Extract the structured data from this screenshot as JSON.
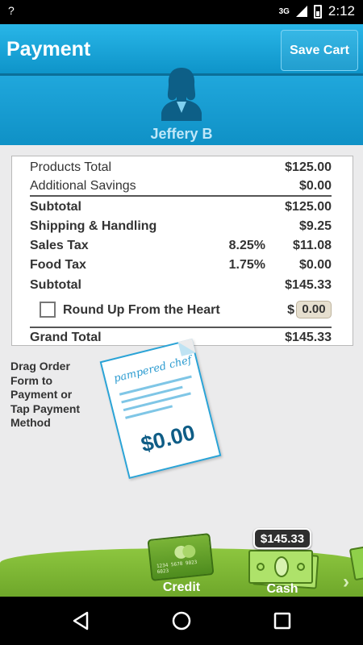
{
  "status_bar": {
    "left_icon": "?",
    "network": "3G",
    "time": "2:12"
  },
  "header": {
    "title": "Payment",
    "save_label": "Save Cart"
  },
  "profile": {
    "name": "Jeffery B",
    "avatar_icon": "person-silhouette-icon"
  },
  "totals": {
    "products_total_label": "Products Total",
    "products_total_value": "$125.00",
    "additional_savings_label": "Additional Savings",
    "additional_savings_value": "$0.00",
    "subtotal1_label": "Subtotal",
    "subtotal1_value": "$125.00",
    "shipping_label": "Shipping & Handling",
    "shipping_value": "$9.25",
    "sales_tax_label": "Sales Tax",
    "sales_tax_rate": "8.25%",
    "sales_tax_value": "$11.08",
    "food_tax_label": "Food Tax",
    "food_tax_rate": "1.75%",
    "food_tax_value": "$0.00",
    "subtotal2_label": "Subtotal",
    "subtotal2_value": "$145.33",
    "round_up_label": "Round Up From the Heart",
    "round_up_currency": "$",
    "round_up_value": "0.00",
    "round_up_checked": false,
    "grand_total_label": "Grand Total",
    "grand_total_value": "$145.33"
  },
  "drag_area": {
    "instruction": "Drag Order Form to Payment or Tap Payment Method",
    "form_brand": "pampered chef",
    "form_amount": "$0.00"
  },
  "payment_methods": {
    "credit_label": "Credit",
    "credit_card_number": "1234 5678 9023 6023",
    "cash_label": "Cash",
    "cash_amount": "$145.33"
  },
  "colors": {
    "header_blue": "#1aa4dc",
    "tray_green": "#7fb935",
    "form_blue": "#0f5d86"
  }
}
